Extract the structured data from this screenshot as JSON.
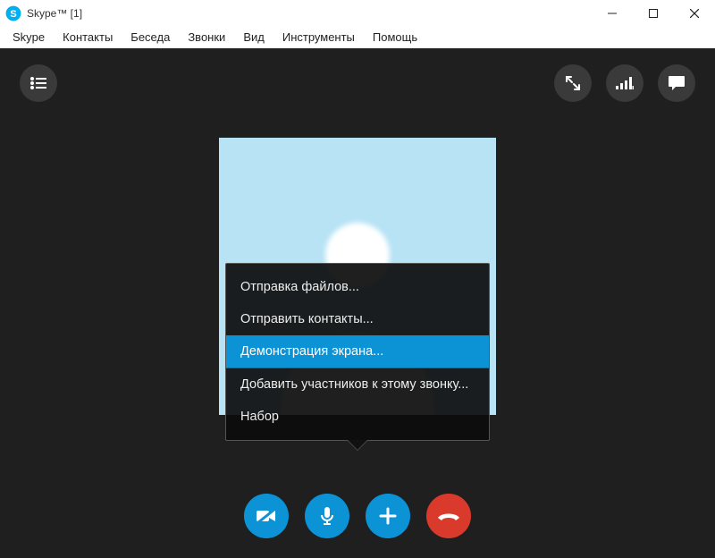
{
  "window": {
    "title": "Skype™ [1]"
  },
  "menu": {
    "items": [
      "Skype",
      "Контакты",
      "Беседа",
      "Звонки",
      "Вид",
      "Инструменты",
      "Помощь"
    ]
  },
  "popup": {
    "items": [
      {
        "label": "Отправка файлов...",
        "selected": false,
        "sep": false
      },
      {
        "label": "Отправить контакты...",
        "selected": false,
        "sep": false
      },
      {
        "label": "Демонстрация экрана...",
        "selected": true,
        "sep": false
      },
      {
        "label": "Добавить участников к этому звонку...",
        "selected": false,
        "sep": true
      },
      {
        "label": "Набор",
        "selected": false,
        "sep": false
      }
    ]
  },
  "icons": {
    "recent_list": "recent-list-icon",
    "fullscreen": "fullscreen-icon",
    "quality": "call-quality-icon",
    "chat": "chat-icon",
    "camera_off": "camera-off-icon",
    "mic": "microphone-icon",
    "add": "plus-icon",
    "hangup": "hangup-icon"
  },
  "colors": {
    "accent": "#0b93d6",
    "hangup": "#d93a2b",
    "call_bg": "#1f1f1f",
    "avatar_bg": "#b7e3f5"
  }
}
